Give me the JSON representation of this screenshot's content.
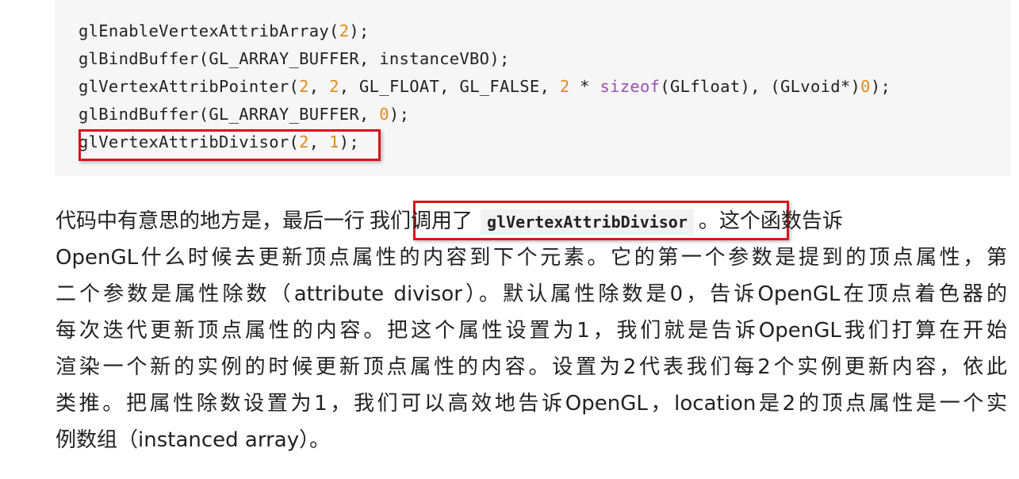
{
  "code": {
    "line1": {
      "a": "glEnableVertexAttribArray(",
      "n1": "2",
      "b": ");"
    },
    "line2": {
      "a": "glBindBuffer(GL_ARRAY_BUFFER, instanceVBO);"
    },
    "line3": {
      "a": "glVertexAttribPointer(",
      "n1": "2",
      "b": ", ",
      "n2": "2",
      "c": ", GL_FLOAT, GL_FALSE, ",
      "n3": "2",
      "d": " * ",
      "kw": "sizeof",
      "e": "(GLfloat), (GLvoid*)",
      "n4": "0",
      "f": ");"
    },
    "line4": {
      "a": "glBindBuffer(GL_ARRAY_BUFFER, ",
      "n1": "0",
      "b": ");"
    },
    "line5": {
      "a": "glVertexAttribDivisor(",
      "n1": "2",
      "b": ", ",
      "n2": "1",
      "c": ");"
    }
  },
  "paragraph": {
    "line1_before": "代码中有意思的地方是，最后一行",
    "line1_highlight_text": "我们调用了",
    "line1_code": "glVertexAttribDivisor",
    "line1_after": "。这个函数告诉",
    "line2": "OpenGL什么时候去更新顶点属性的内容到下个元素。它的第一个参数是提到的顶点属性，第",
    "line3": "二个参数是属性除数（attribute divisor）。默认属性除数是0，告诉OpenGL在顶点着色器的",
    "line4": "每次迭代更新顶点属性的内容。把这个属性设置为1，我们就是告诉OpenGL我们打算在开始",
    "line5": "渲染一个新的实例的时候更新顶点属性的内容。设置为2代表我们每2个实例更新内容，依此",
    "line6": "类推。把属性除数设置为1，我们可以高效地告诉OpenGL，location是2的顶点属性是一个实",
    "line7": "例数组（instanced array）。"
  },
  "colors": {
    "highlight_border": "#d9141b",
    "number": "#e8891c",
    "keyword": "#9b4fb5",
    "code_background": "#f6f6f6"
  }
}
